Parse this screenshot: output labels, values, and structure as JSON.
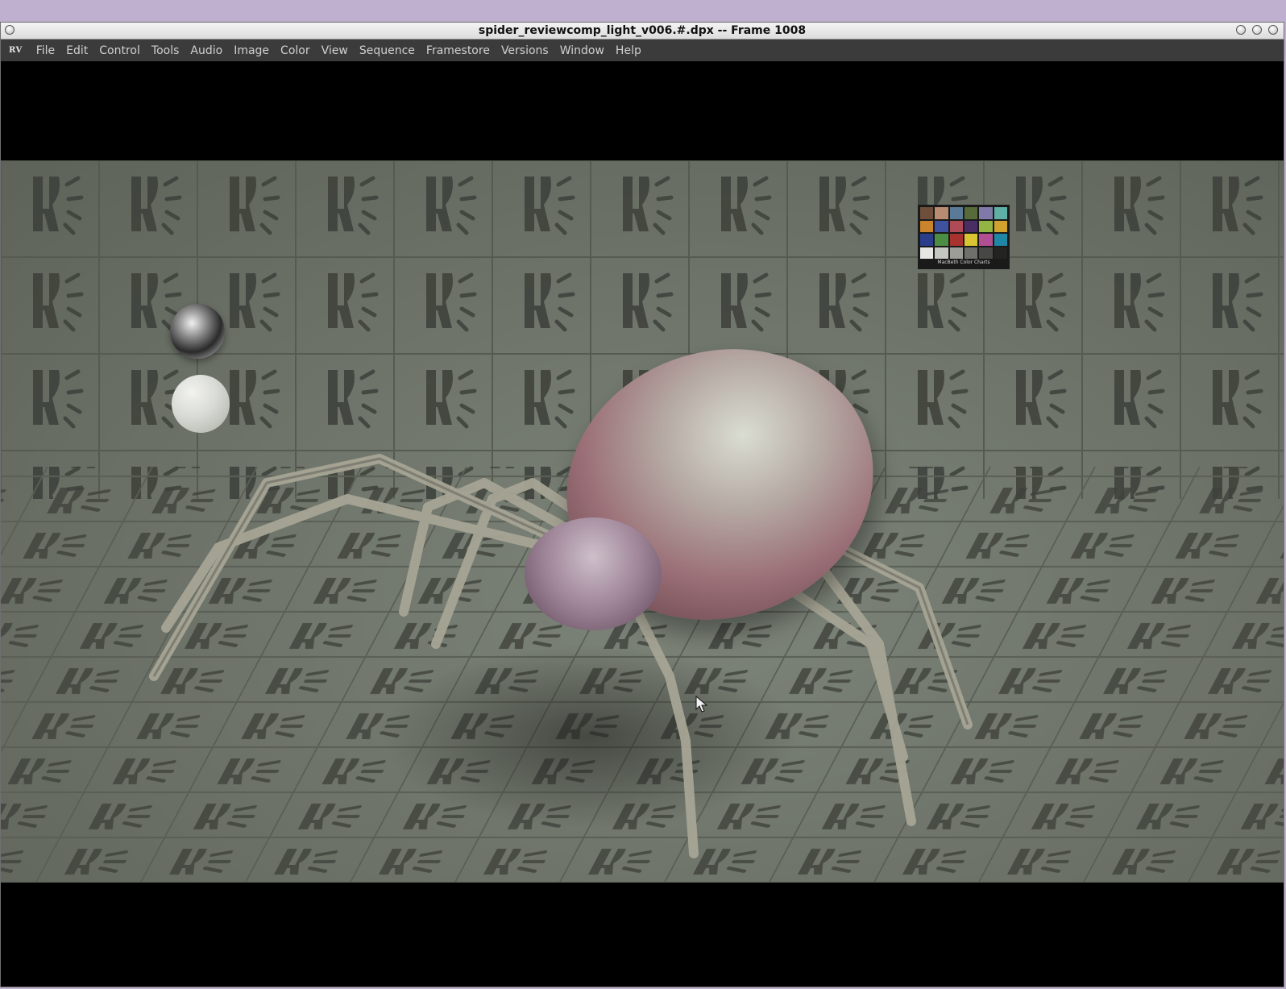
{
  "window": {
    "title": "spider_reviewcomp_light_v006.#.dpx -- Frame 1008",
    "app_logo": "RV"
  },
  "menu": {
    "items": [
      {
        "label": "File"
      },
      {
        "label": "Edit"
      },
      {
        "label": "Control"
      },
      {
        "label": "Tools"
      },
      {
        "label": "Audio"
      },
      {
        "label": "Image"
      },
      {
        "label": "Color"
      },
      {
        "label": "View"
      },
      {
        "label": "Sequence"
      },
      {
        "label": "Framestore"
      },
      {
        "label": "Versions"
      },
      {
        "label": "Window"
      },
      {
        "label": "Help"
      }
    ]
  },
  "viewer": {
    "color_chart_label": "MacBeth Color Charts",
    "swatches": [
      "#6d4f3b",
      "#b88b73",
      "#5b7a98",
      "#576a3a",
      "#7f7aa8",
      "#5fb0a5",
      "#c9842c",
      "#3f52a0",
      "#b04a57",
      "#4a2e63",
      "#93b542",
      "#d1a22e",
      "#2a3e8c",
      "#4a8d43",
      "#a8322e",
      "#d9c531",
      "#b14f92",
      "#1f86a6",
      "#e6e6e2",
      "#c4c6c0",
      "#9c9d98",
      "#6f706b",
      "#474844",
      "#232421"
    ]
  }
}
